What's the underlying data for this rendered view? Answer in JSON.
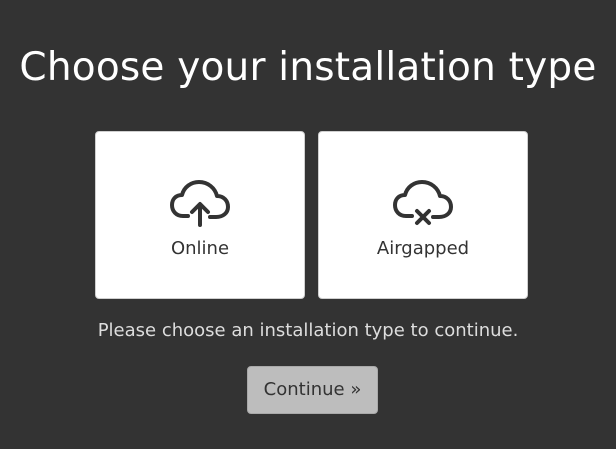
{
  "page": {
    "title": "Choose your installation type",
    "hint": "Please choose an installation type to continue."
  },
  "options": [
    {
      "label": "Online",
      "icon": "cloud-upload-icon"
    },
    {
      "label": "Airgapped",
      "icon": "cloud-offline-icon"
    }
  ],
  "actions": {
    "continue_label": "Continue »",
    "continue_enabled": false
  },
  "colors": {
    "background": "#333333",
    "card": "#ffffff",
    "text": "#333333",
    "button_disabled": "#bdbdbd"
  }
}
